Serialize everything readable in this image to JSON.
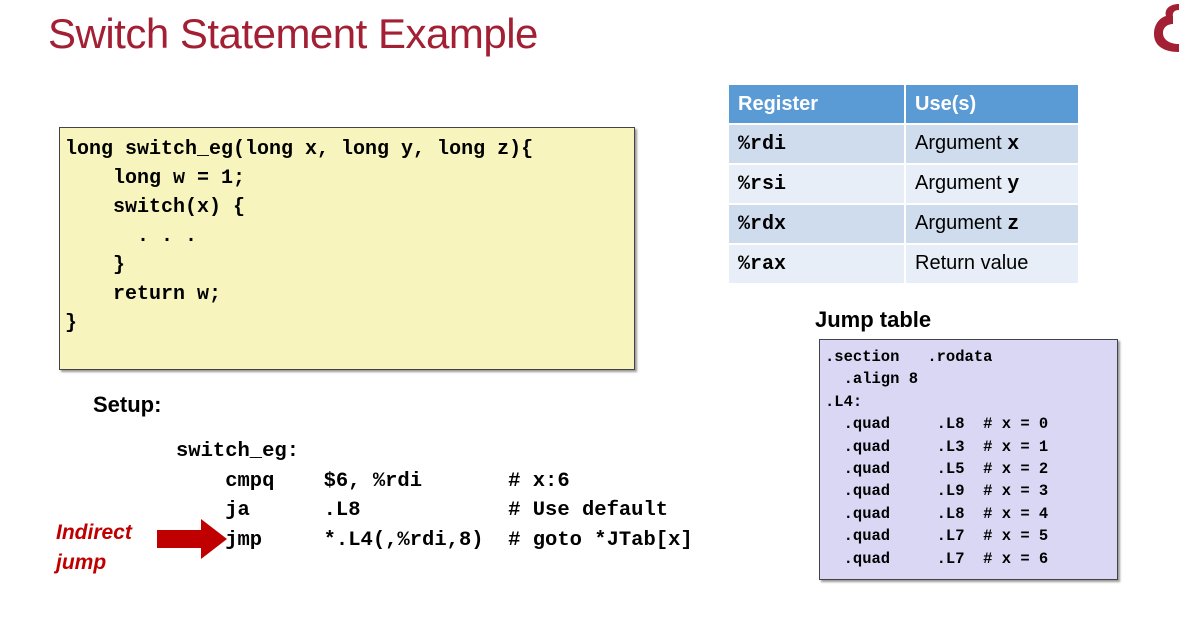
{
  "slide": {
    "title": "Switch Statement Example"
  },
  "code": {
    "lines": [
      "long switch_eg(long x, long y, long z){",
      "    long w = 1;",
      "    switch(x) {",
      "      . . .",
      "    }",
      "    return w;",
      "}"
    ]
  },
  "register_table": {
    "headers": [
      "Register",
      "Use(s)"
    ],
    "rows": [
      {
        "register": "%rdi",
        "use": "Argument ",
        "arg": "x"
      },
      {
        "register": "%rsi",
        "use": "Argument ",
        "arg": "y"
      },
      {
        "register": "%rdx",
        "use": "Argument ",
        "arg": "z"
      },
      {
        "register": "%rax",
        "use": "Return value",
        "arg": ""
      }
    ]
  },
  "setup": {
    "label": "Setup:",
    "lines": [
      "switch_eg:",
      "    cmpq    $6, %rdi       # x:6",
      "    ja      .L8            # Use default",
      "    jmp     *.L4(,%rdi,8)  # goto *JTab[x]"
    ]
  },
  "indirect_jump": {
    "line1": "Indirect",
    "line2": "jump"
  },
  "jump_table": {
    "heading": "Jump table",
    "lines": [
      ".section   .rodata",
      "  .align 8",
      ".L4:",
      "  .quad     .L8  # x = 0",
      "  .quad     .L3  # x = 1",
      "  .quad     .L5  # x = 2",
      "  .quad     .L9  # x = 3",
      "  .quad     .L8  # x = 4",
      "  .quad     .L7  # x = 5",
      "  .quad     .L7  # x = 6"
    ]
  },
  "colors": {
    "title": "#a31f34",
    "code_bg": "#f7f5bd",
    "jump_table_bg": "#d9d7f3",
    "table_header": "#5b9bd5",
    "arrow": "#c00000"
  }
}
